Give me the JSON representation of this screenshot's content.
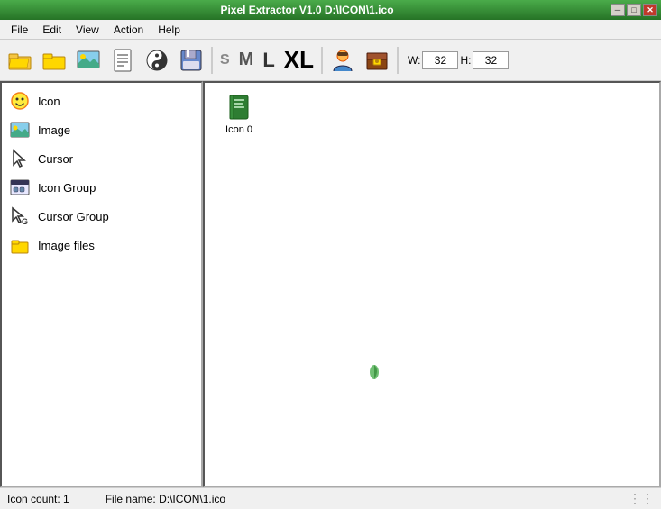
{
  "titleBar": {
    "title": "Pixel Extractor V1.0  D:\\ICON\\1.ico",
    "minBtn": "─",
    "maxBtn": "□",
    "closeBtn": "✕"
  },
  "menu": {
    "items": [
      "File",
      "Edit",
      "View",
      "Action",
      "Help"
    ]
  },
  "toolbar": {
    "sizeLabels": [
      "S",
      "M",
      "L",
      "XL"
    ],
    "wLabel": "W:",
    "hLabel": "H:",
    "wValue": "32",
    "hValue": "32"
  },
  "leftPanel": {
    "items": [
      {
        "id": "icon",
        "label": "Icon"
      },
      {
        "id": "image",
        "label": "Image"
      },
      {
        "id": "cursor",
        "label": "Cursor"
      },
      {
        "id": "icon-group",
        "label": "Icon Group"
      },
      {
        "id": "cursor-group",
        "label": "Cursor Group"
      },
      {
        "id": "image-files",
        "label": "Image files"
      }
    ]
  },
  "rightPanel": {
    "icons": [
      {
        "label": "Icon 0"
      }
    ]
  },
  "statusBar": {
    "iconCount": "Icon count: 1",
    "fileName": "File name: D:\\ICON\\1.ico"
  }
}
